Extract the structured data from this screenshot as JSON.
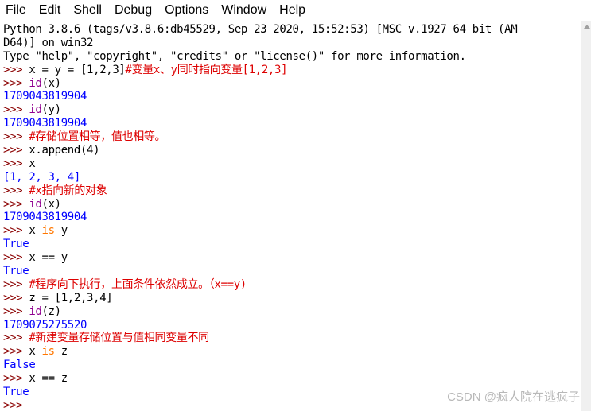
{
  "menu": [
    "File",
    "Edit",
    "Shell",
    "Debug",
    "Options",
    "Window",
    "Help"
  ],
  "prompt": ">>> ",
  "lines": [
    {
      "type": "out_plain",
      "parts": [
        {
          "c": "code",
          "t": "Python 3.8.6 (tags/v3.8.6:db45529, Sep 23 2020, 15:52:53) [MSC v.1927 64 bit (AM"
        }
      ]
    },
    {
      "type": "out_plain",
      "parts": [
        {
          "c": "code",
          "t": "D64)] on win32"
        }
      ]
    },
    {
      "type": "out_plain",
      "parts": [
        {
          "c": "code",
          "t": "Type \"help\", \"copyright\", \"credits\" or \"license()\" for more information."
        }
      ]
    },
    {
      "type": "input",
      "parts": [
        {
          "c": "code",
          "t": "x = y = [1,2,3]"
        },
        {
          "c": "comment",
          "t": "#变量x、y同时指向变量[1,2,3]"
        }
      ]
    },
    {
      "type": "input",
      "parts": [
        {
          "c": "builtin",
          "t": "id"
        },
        {
          "c": "code",
          "t": "(x)"
        }
      ]
    },
    {
      "type": "output",
      "parts": [
        {
          "c": "out",
          "t": "1709043819904"
        }
      ]
    },
    {
      "type": "input",
      "parts": [
        {
          "c": "builtin",
          "t": "id"
        },
        {
          "c": "code",
          "t": "(y)"
        }
      ]
    },
    {
      "type": "output",
      "parts": [
        {
          "c": "out",
          "t": "1709043819904"
        }
      ]
    },
    {
      "type": "input",
      "parts": [
        {
          "c": "comment",
          "t": "#存储位置相等，值也相等。"
        }
      ]
    },
    {
      "type": "input",
      "parts": [
        {
          "c": "code",
          "t": "x.append(4)"
        }
      ]
    },
    {
      "type": "input",
      "parts": [
        {
          "c": "code",
          "t": "x"
        }
      ]
    },
    {
      "type": "output",
      "parts": [
        {
          "c": "out",
          "t": "[1, 2, 3, 4]"
        }
      ]
    },
    {
      "type": "input",
      "parts": [
        {
          "c": "comment",
          "t": "#x指向新的对象"
        }
      ]
    },
    {
      "type": "input",
      "parts": [
        {
          "c": "builtin",
          "t": "id"
        },
        {
          "c": "code",
          "t": "(x)"
        }
      ]
    },
    {
      "type": "output",
      "parts": [
        {
          "c": "out",
          "t": "1709043819904"
        }
      ]
    },
    {
      "type": "input",
      "parts": [
        {
          "c": "code",
          "t": "x "
        },
        {
          "c": "kw",
          "t": "is"
        },
        {
          "c": "code",
          "t": " y"
        }
      ]
    },
    {
      "type": "output",
      "parts": [
        {
          "c": "out",
          "t": "True"
        }
      ]
    },
    {
      "type": "input",
      "parts": [
        {
          "c": "code",
          "t": "x == y"
        }
      ]
    },
    {
      "type": "output",
      "parts": [
        {
          "c": "out",
          "t": "True"
        }
      ]
    },
    {
      "type": "input",
      "parts": [
        {
          "c": "comment",
          "t": "#程序向下执行，上面条件依然成立。（x==y)"
        }
      ]
    },
    {
      "type": "input",
      "parts": [
        {
          "c": "code",
          "t": "z = [1,2,3,4]"
        }
      ]
    },
    {
      "type": "input",
      "parts": [
        {
          "c": "builtin",
          "t": "id"
        },
        {
          "c": "code",
          "t": "(z)"
        }
      ]
    },
    {
      "type": "output",
      "parts": [
        {
          "c": "out",
          "t": "1709075275520"
        }
      ]
    },
    {
      "type": "input",
      "parts": [
        {
          "c": "comment",
          "t": "#新建变量存储位置与值相同变量不同"
        }
      ]
    },
    {
      "type": "input",
      "parts": [
        {
          "c": "code",
          "t": "x "
        },
        {
          "c": "kw",
          "t": "is"
        },
        {
          "c": "code",
          "t": " z"
        }
      ]
    },
    {
      "type": "output",
      "parts": [
        {
          "c": "out",
          "t": "False"
        }
      ]
    },
    {
      "type": "input",
      "parts": [
        {
          "c": "code",
          "t": "x == z"
        }
      ]
    },
    {
      "type": "output",
      "parts": [
        {
          "c": "out",
          "t": "True"
        }
      ]
    },
    {
      "type": "input",
      "parts": []
    }
  ],
  "watermark": "CSDN @疯人院在逃疯子",
  "colors": {
    "prompt": "#8b0000",
    "comment": "#dd0000",
    "builtin": "#900090",
    "keyword": "#ff7700",
    "output": "#0000ff"
  }
}
